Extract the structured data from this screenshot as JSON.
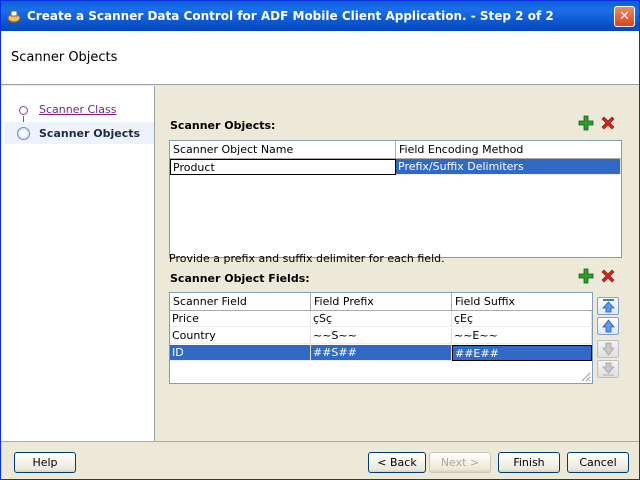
{
  "window": {
    "title": "Create a Scanner Data Control for ADF Mobile Client Application. - Step 2 of 2",
    "close_label": "✕"
  },
  "header": {
    "title": "Scanner Objects"
  },
  "nav": {
    "items": [
      {
        "label": "Scanner Class"
      },
      {
        "label": "Scanner Objects"
      }
    ]
  },
  "objects": {
    "label": "Scanner Objects:",
    "columns": [
      "Scanner Object Name",
      "Field Encoding Method"
    ],
    "rows": [
      [
        "Product",
        "Prefix/Suffix Delimiters"
      ]
    ]
  },
  "fields": {
    "hint": "Provide a prefix and suffix delimiter for each field.",
    "label": "Scanner Object Fields:",
    "columns": [
      "Scanner Field",
      "Field Prefix",
      "Field Suffix"
    ],
    "rows": [
      [
        "Price",
        "çSç",
        "çEç"
      ],
      [
        "Country",
        "~~S~~",
        "~~E~~"
      ],
      [
        "ID",
        "##S##",
        "##E##"
      ]
    ]
  },
  "buttons": {
    "help": "Help",
    "back": "< Back",
    "next": "Next >",
    "finish": "Finish",
    "cancel": "Cancel"
  },
  "colors": {
    "accent": "#316ac5",
    "add": "#2a9d2a",
    "remove": "#d0281b"
  },
  "icons": {
    "add": "plus-icon",
    "remove": "delete-icon",
    "up": "arrow-up-icon",
    "down": "arrow-down-icon"
  }
}
